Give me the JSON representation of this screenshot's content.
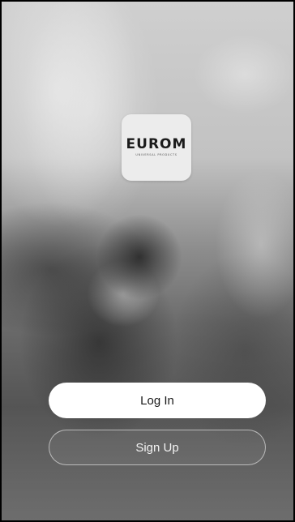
{
  "brand": {
    "logo_text": "EUROM",
    "logo_tagline": "UNIVERSAL PRODUCTS"
  },
  "actions": {
    "login_label": "Log In",
    "signup_label": "Sign Up"
  },
  "colors": {
    "login_button_bg": "#ffffff",
    "signup_button_border": "rgba(255,255,255,0.55)",
    "logo_tile_bg": "#ececec"
  }
}
